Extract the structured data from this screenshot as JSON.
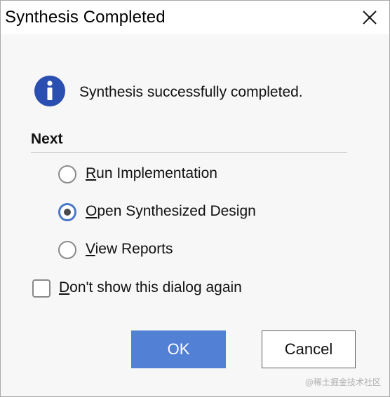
{
  "window": {
    "title": "Synthesis Completed"
  },
  "message": {
    "icon": "info-icon",
    "text": "Synthesis successfully completed."
  },
  "next_section": {
    "label": "Next",
    "options": [
      {
        "mnemonic": "R",
        "rest": "un Implementation",
        "selected": false
      },
      {
        "mnemonic": "O",
        "rest": "pen Synthesized Design",
        "selected": true
      },
      {
        "mnemonic": "V",
        "rest": "iew Reports",
        "selected": false
      }
    ]
  },
  "dont_show": {
    "mnemonic": "D",
    "rest": "on't show this dialog again",
    "checked": false
  },
  "buttons": {
    "ok_label": "OK",
    "cancel_label": "Cancel"
  },
  "colors": {
    "accent": "#5180d4",
    "info_icon": "#2a4fb0"
  },
  "watermark": "@稀土掘金技术社区"
}
